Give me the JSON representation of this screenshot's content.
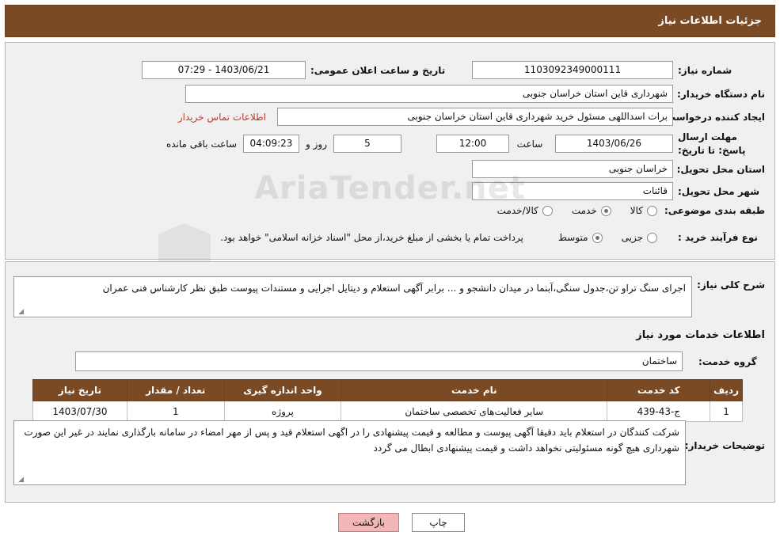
{
  "header": {
    "title": "جزئیات اطلاعات نیاز"
  },
  "form": {
    "need_number_label": "شماره نیاز:",
    "need_number_value": "1103092349000111",
    "announce_datetime_label": "تاریخ و ساعت اعلان عمومی:",
    "announce_datetime_value": "1403/06/21 - 07:29",
    "buyer_org_label": "نام دستگاه خریدار:",
    "buyer_org_value": "شهرداری قاین استان خراسان جنوبی",
    "requester_label": "ایجاد کننده درخواست:",
    "requester_value": "برات اسداللهی مسئول خرید شهرداری قاین استان خراسان جنوبی",
    "contact_link": "اطلاعات تماس خریدار",
    "deadline_label": "مهلت ارسال پاسخ: تا تاریخ:",
    "deadline_date": "1403/06/26",
    "hour_label": "ساعت",
    "deadline_time": "12:00",
    "days_value": "5",
    "days_label": "روز و",
    "remaining_time": "04:09:23",
    "remaining_label": "ساعت باقی مانده",
    "province_label": "استان محل تحویل:",
    "province_value": "خراسان جنوبی",
    "city_label": "شهر محل تحویل:",
    "city_value": "قائنات",
    "category_label": "طبقه بندی موضوعی:",
    "category_options": [
      "کالا",
      "خدمت",
      "کالا/خدمت"
    ],
    "category_selected": "خدمت",
    "process_label": "نوع فرآیند خرید :",
    "process_options": [
      "جزیی",
      "متوسط"
    ],
    "process_selected": "متوسط",
    "process_note": "پرداخت تمام یا بخشی از مبلغ خرید،از محل \"اسناد خزانه اسلامی\" خواهد بود."
  },
  "watermark": "AriaTender.net",
  "description": {
    "label": "شرح کلی نیاز:",
    "value": "اجرای سنگ تراو تن،جدول سنگی،آبنما در میدان دانشجو و ... برابر  آگهی استعلام و دیتایل اجرایی و مستندات پیوست طبق نظر کارشناس فنی عمران"
  },
  "services": {
    "section_title": "اطلاعات خدمات مورد نیاز",
    "group_label": "گروه خدمت:",
    "group_value": "ساختمان",
    "columns": [
      "ردیف",
      "کد خدمت",
      "نام خدمت",
      "واحد اندازه گیری",
      "تعداد / مقدار",
      "تاریخ نیاز"
    ],
    "rows": [
      {
        "index": "1",
        "code": "ج-43-439",
        "name": "سایر فعالیت‌های تخصصی ساختمان",
        "unit": "پروژه",
        "quantity": "1",
        "date": "1403/07/30"
      }
    ]
  },
  "buyer_notes": {
    "label": "توضیحات خریدار:",
    "value": "شرکت کنندگان در استعلام باید دقیقا آگهی پیوست و مطالعه و قیمت پیشنهادی را در اگهی استعلام قید و پس از مهر امضاء در سامانه بارگذاری نمایند در غیر این صورت شهرداری هیچ گونه مسئولیتی نخواهد داشت و قیمت پیشنهادی ابطال می گردد"
  },
  "footer": {
    "print_label": "چاپ",
    "back_label": "بازگشت"
  }
}
